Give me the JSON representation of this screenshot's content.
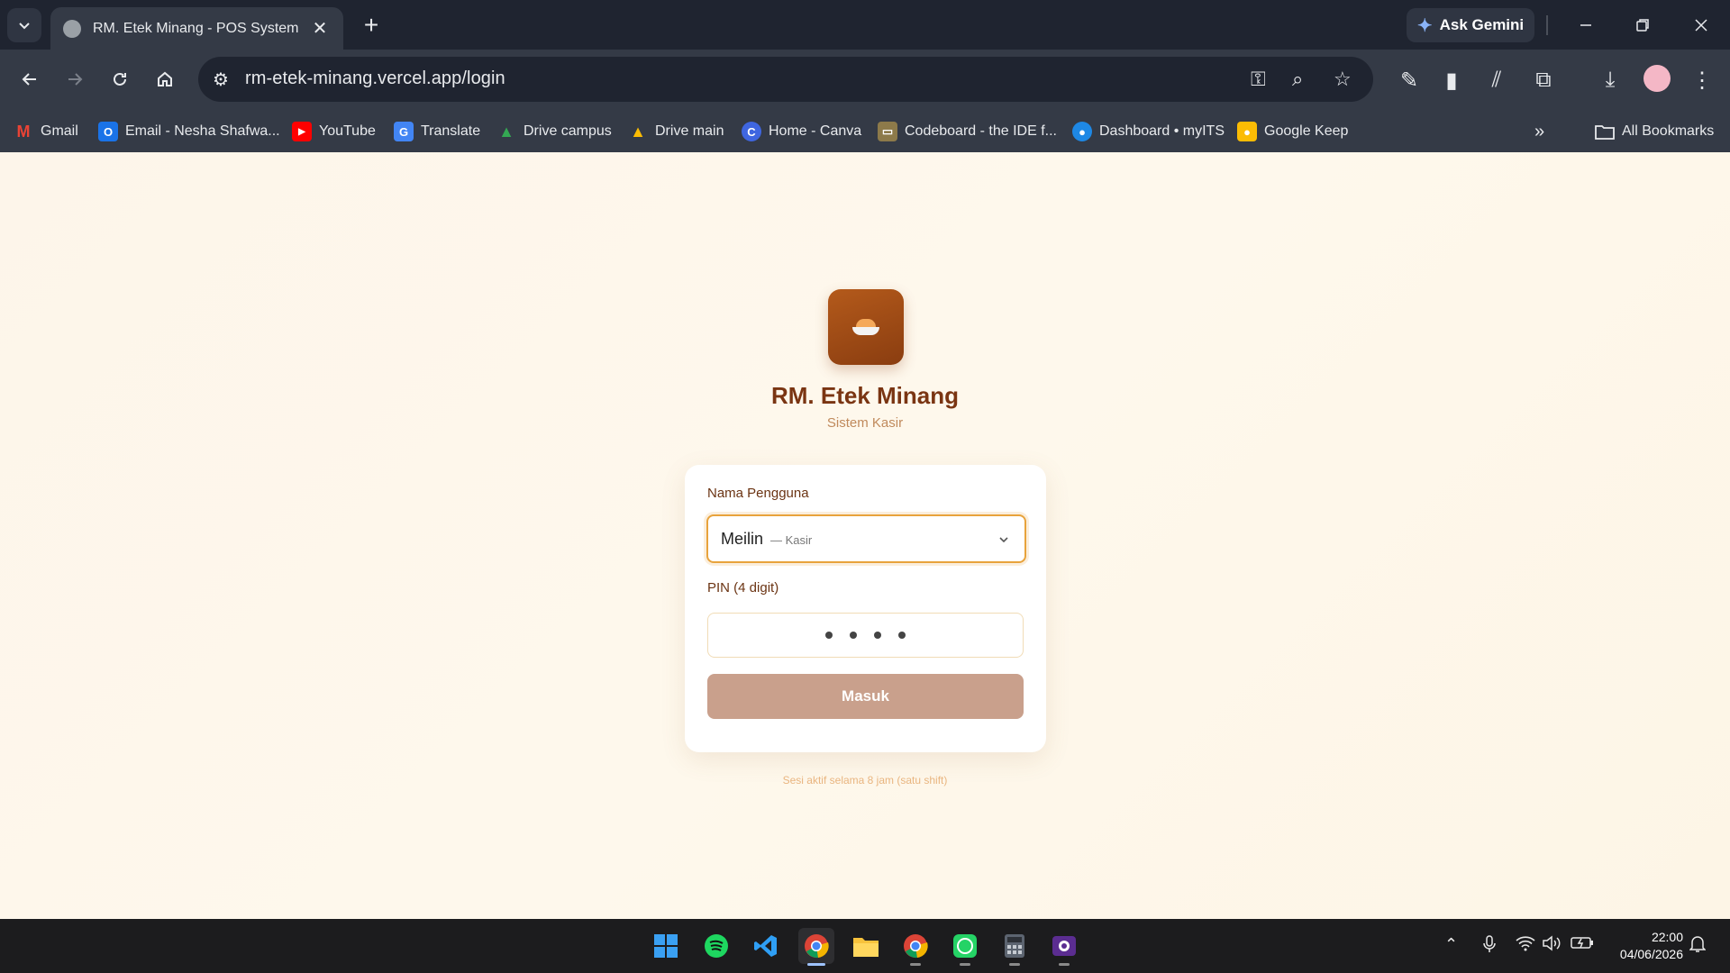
{
  "browser": {
    "tab_title": "RM. Etek Minang - POS System",
    "tab_close": "✕",
    "new_tab": "+",
    "gemini_label": "Ask Gemini",
    "url": "rm-etek-minang.vercel.app/login"
  },
  "bookmarks": [
    {
      "label": "Gmail",
      "icon": "gmail-icon",
      "color": "#ea4335",
      "glyph": "M"
    },
    {
      "label": "Email - Nesha Shafwa...",
      "icon": "outlook-icon",
      "color": "#1a73e8",
      "glyph": "O"
    },
    {
      "label": "YouTube",
      "icon": "youtube-icon",
      "color": "#ff0000",
      "glyph": "▶"
    },
    {
      "label": "Translate",
      "icon": "translate-icon",
      "color": "#4285f4",
      "glyph": "G"
    },
    {
      "label": "Drive campus",
      "icon": "drive-icon",
      "color": "#34a853",
      "glyph": "▲"
    },
    {
      "label": "Drive main",
      "icon": "drive-icon",
      "color": "#fbbc04",
      "glyph": "▲"
    },
    {
      "label": "Home - Canva",
      "icon": "canva-icon",
      "color": "#3f66e0",
      "glyph": "C"
    },
    {
      "label": "Codeboard - the IDE f...",
      "icon": "codeboard-icon",
      "color": "#8d7a4a",
      "glyph": "▭"
    },
    {
      "label": "Dashboard • myITS",
      "icon": "myits-icon",
      "color": "#1e88e5",
      "glyph": "●"
    },
    {
      "label": "Google Keep",
      "icon": "keep-icon",
      "color": "#fbbc04",
      "glyph": "●"
    }
  ],
  "bookmarks_more": "»",
  "all_bookmarks": "All Bookmarks",
  "app": {
    "title": "RM. Etek Minang",
    "subtitle": "Sistem Kasir"
  },
  "login": {
    "user_label": "Nama Pengguna",
    "selected_user": "Meilin",
    "selected_role": "— Kasir",
    "pin_label": "PIN (4 digit)",
    "pin_length": 4,
    "submit_label": "Masuk",
    "session_note": "Sesi aktif selama 8 jam (satu shift)"
  },
  "colors": {
    "brand": "#8a3d10",
    "accent": "#e8a33c",
    "button": "#c9a08c"
  },
  "taskbar": {
    "apps": [
      "windows-start-icon",
      "spotify-icon",
      "vscode-icon",
      "chrome-icon",
      "file-explorer-icon",
      "chrome-profile-icon",
      "whatsapp-icon",
      "calculator-icon",
      "github-desktop-icon"
    ],
    "time": "22:00",
    "date": "04/06/2026"
  }
}
